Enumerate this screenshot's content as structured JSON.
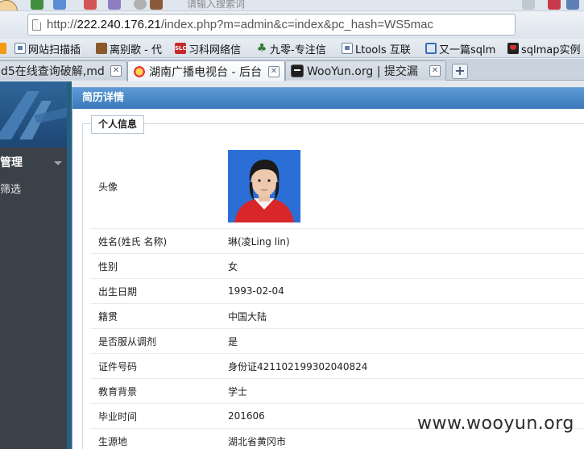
{
  "browser": {
    "top_strip": {
      "search_hint": "请输入搜索词"
    },
    "address_bar": {
      "scheme": "http://",
      "host": "222.240.176.21",
      "path": "/index.php?m=admin&c=index&pc_hash=WS5mac"
    },
    "bookmarks": [
      {
        "label": "",
        "icon": "rss-icon"
      },
      {
        "label": "网站扫描插",
        "icon": "folder-icon"
      },
      {
        "label": "离别歌 - 代",
        "icon": "dog-icon"
      },
      {
        "label": "习科网络信",
        "icon": "slc-icon"
      },
      {
        "label": "九零-专注信",
        "icon": "leaf-icon"
      },
      {
        "label": "Ltools 互联",
        "icon": "folder-icon"
      },
      {
        "label": "又一篇sqlm",
        "icon": "shield-icon"
      },
      {
        "label": "sqlmap实例",
        "icon": "shield-red-icon"
      }
    ],
    "tabs": [
      {
        "label": "d5在线查询破解,md",
        "active": false
      },
      {
        "label": "湖南广播电视台 - 后台",
        "active": true
      },
      {
        "label": "WooYun.org | 提交漏",
        "active": false
      }
    ]
  },
  "admin": {
    "menu_heading": "管理",
    "menu_item": "筛选"
  },
  "dialog": {
    "title": "简历详情",
    "section": "个人信息",
    "photo_label": "头像",
    "rows": [
      {
        "label": "姓名(姓氏 名称)",
        "value": "琳(凌Ling lin)"
      },
      {
        "label": "性别",
        "value": "女"
      },
      {
        "label": "出生日期",
        "value": "1993-02-04"
      },
      {
        "label": "籍贯",
        "value": "中国大陆"
      },
      {
        "label": "是否服从调剂",
        "value": "是"
      },
      {
        "label": "证件号码",
        "value": "身份证421102199302040824"
      },
      {
        "label": "教育背景",
        "value": "学士"
      },
      {
        "label": "毕业时间",
        "value": "201606"
      },
      {
        "label": "生源地",
        "value": "湖北省黄冈市"
      }
    ]
  },
  "watermark": "www.wooyun.org",
  "colors": {
    "dialog_title_bg": "#3a78bb",
    "sidebar_bg": "#3b4148",
    "photo_bg": "#2b6fd6"
  }
}
